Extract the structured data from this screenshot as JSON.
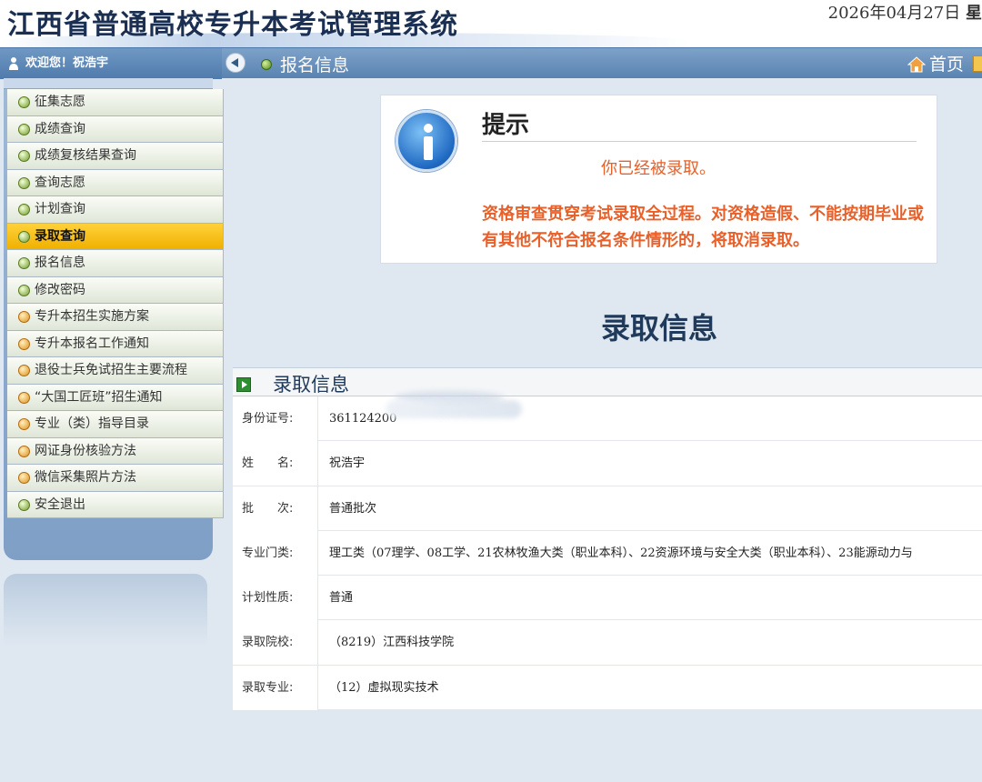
{
  "header": {
    "title": "江西省普通高校专升本考试管理系统",
    "date": "2026年04月27日",
    "weekday_partial": "星期"
  },
  "topbar": {
    "welcome": "欢迎您！祝浩宇",
    "breadcrumb": "报名信息",
    "home_label": "首页"
  },
  "sidebar": {
    "items": [
      {
        "label": "征集志愿",
        "dot": "green"
      },
      {
        "label": "成绩查询",
        "dot": "green"
      },
      {
        "label": "成绩复核结果查询",
        "dot": "green"
      },
      {
        "label": "查询志愿",
        "dot": "green"
      },
      {
        "label": "计划查询",
        "dot": "green"
      },
      {
        "label": "录取查询",
        "dot": "green",
        "active": true
      },
      {
        "label": "报名信息",
        "dot": "green"
      },
      {
        "label": "修改密码",
        "dot": "green"
      },
      {
        "label": "专升本招生实施方案",
        "dot": "orange"
      },
      {
        "label": "专升本报名工作通知",
        "dot": "orange"
      },
      {
        "label": "退役士兵免试招生主要流程",
        "dot": "orange"
      },
      {
        "label": "“大国工匠班”招生通知",
        "dot": "orange"
      },
      {
        "label": "专业（类）指导目录",
        "dot": "orange"
      },
      {
        "label": "网证身份核验方法",
        "dot": "orange"
      },
      {
        "label": "微信采集照片方法",
        "dot": "orange"
      },
      {
        "label": "安全退出",
        "dot": "green"
      }
    ]
  },
  "notice": {
    "title": "提示",
    "message": "你已经被录取。",
    "body": "资格审查贯穿考试录取全过程。对资格造假、不能按期毕业或有其他不符合报名条件情形的，将取消录取。"
  },
  "main": {
    "heading": "录取信息",
    "section_title": "录取信息",
    "rows": [
      {
        "label": "身份证号:",
        "value": "361124200"
      },
      {
        "label": "姓　　名:",
        "value": "祝浩宇"
      },
      {
        "label": "批　　次:",
        "value": "普通批次"
      },
      {
        "label": "专业门类:",
        "value": "理工类（07理学、08工学、21农林牧渔大类（职业本科）、22资源环境与安全大类（职业本科）、23能源动力与"
      },
      {
        "label": "计划性质:",
        "value": "普通"
      },
      {
        "label": "录取院校:",
        "value": "（8219）江西科技学院"
      },
      {
        "label": "录取专业:",
        "value": "（12）虚拟现实技术"
      }
    ]
  },
  "colors": {
    "accent_blue": "#5a83b2",
    "active_menu": "#ffd23a",
    "warning_text": "#e8602a",
    "title_text": "#1a2f52"
  },
  "icons": [
    "person-icon",
    "back-icon",
    "green-dot-icon",
    "home-icon",
    "info-icon",
    "arrow-right-icon"
  ]
}
